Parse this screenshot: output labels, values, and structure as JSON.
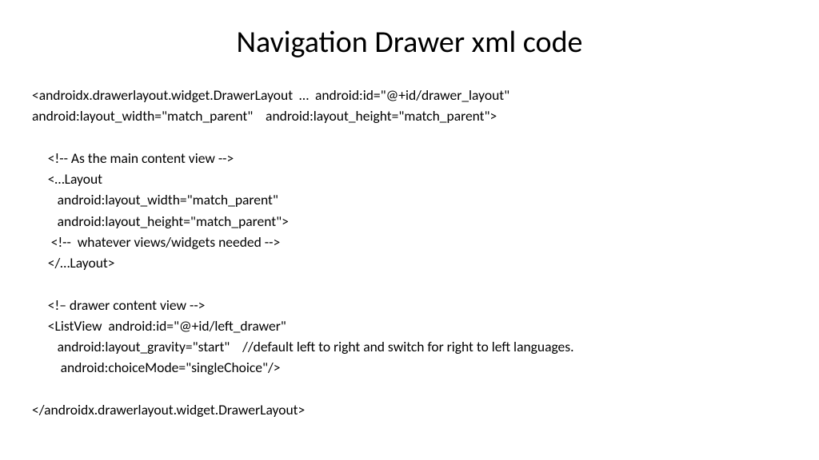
{
  "title": "Navigation Drawer xml code",
  "code_lines": [
    "<androidx.drawerlayout.widget.DrawerLayout  …  android:id=\"@+id/drawer_layout\"",
    "android:layout_width=\"match_parent\"    android:layout_height=\"match_parent\">",
    "",
    "     <!-- As the main content view -->",
    "     <…Layout",
    "        android:layout_width=\"match_parent\"",
    "        android:layout_height=\"match_parent\">",
    "      <!--  whatever views/widgets needed -->",
    "     </…Layout>",
    "",
    "     <!– drawer content view -->",
    "     <ListView  android:id=\"@+id/left_drawer\"",
    "        android:layout_gravity=\"start\"    //default left to right and switch for right to left languages.",
    "         android:choiceMode=\"singleChoice\"/>",
    "",
    "</androidx.drawerlayout.widget.DrawerLayout>"
  ]
}
